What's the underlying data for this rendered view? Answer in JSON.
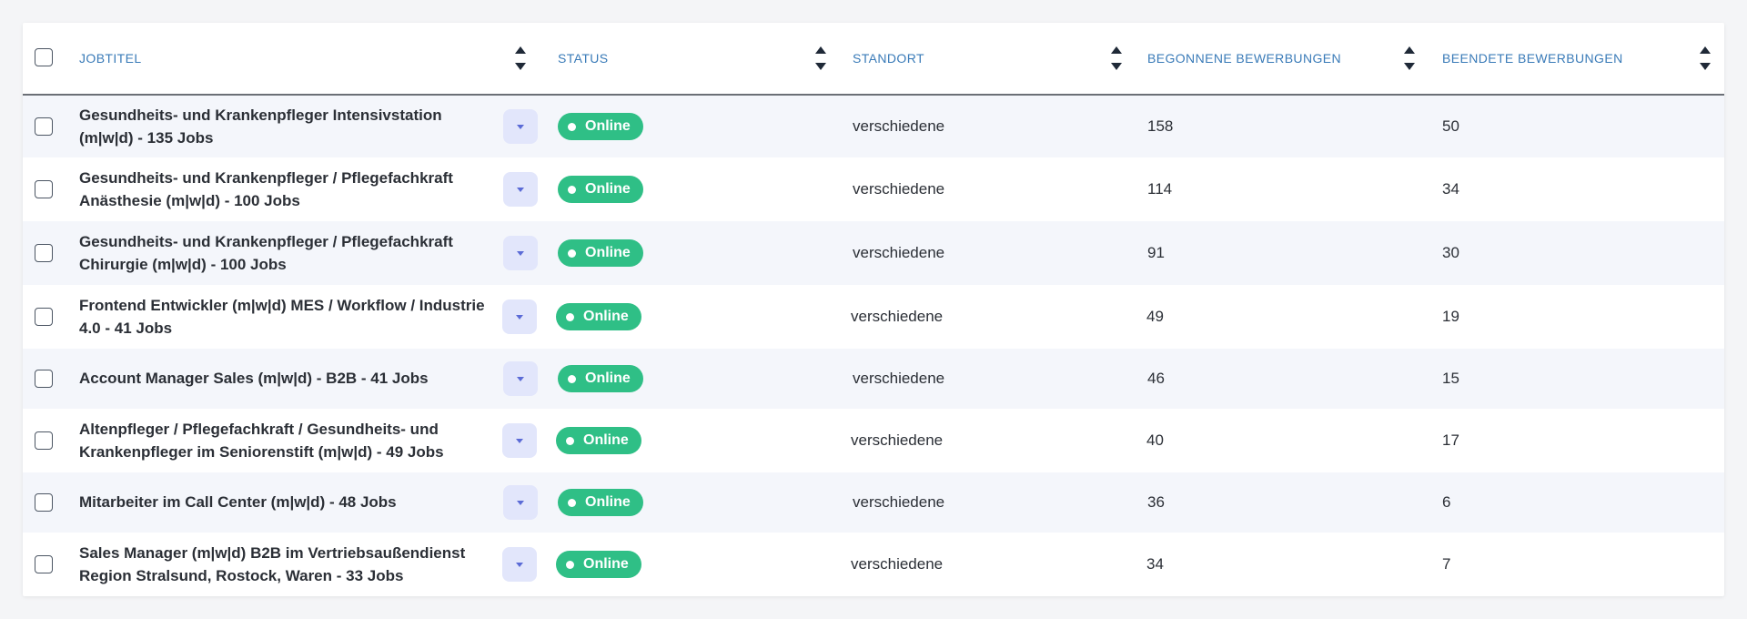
{
  "table": {
    "columns": {
      "jobtitel": "JOBTITEL",
      "status": "STATUS",
      "standort": "STANDORT",
      "begonnene": "BEGONNENE BEWERBUNGEN",
      "beendete": "BEENDETE BEWERBUNGEN"
    },
    "rows": [
      {
        "title": "Gesundheits- und Krankenpfleger Intensivstation (m|w|d) - 135 Jobs",
        "status": "Online",
        "standort": "verschiedene",
        "begonnene": "158",
        "beendete": "50"
      },
      {
        "title": "Gesundheits- und Krankenpfleger / Pflegefachkraft Anästhesie (m|w|d) - 100 Jobs",
        "status": "Online",
        "standort": "verschiedene",
        "begonnene": "114",
        "beendete": "34"
      },
      {
        "title": "Gesundheits- und Krankenpfleger / Pflegefachkraft Chirurgie (m|w|d) - 100 Jobs",
        "status": "Online",
        "standort": "verschiedene",
        "begonnene": "91",
        "beendete": "30"
      },
      {
        "title": "Frontend Entwickler (m|w|d) MES / Workflow / Industrie 4.0 - 41 Jobs",
        "status": "Online",
        "standort": "verschiedene",
        "begonnene": "49",
        "beendete": "19"
      },
      {
        "title": "Account Manager Sales (m|w|d) - B2B - 41 Jobs",
        "status": "Online",
        "standort": "verschiedene",
        "begonnene": "46",
        "beendete": "15"
      },
      {
        "title": "Altenpfleger / Pflegefachkraft / Gesundheits- und Krankenpfleger im Seniorenstift (m|w|d) - 49 Jobs",
        "status": "Online",
        "standort": "verschiedene",
        "begonnene": "40",
        "beendete": "17"
      },
      {
        "title": "Mitarbeiter im Call Center (m|w|d) - 48 Jobs",
        "status": "Online",
        "standort": "verschiedene",
        "begonnene": "36",
        "beendete": "6"
      },
      {
        "title": "Sales Manager (m|w|d) B2B im Vertriebsaußendienst Region Stralsund, Rostock, Waren - 33 Jobs",
        "status": "Online",
        "standort": "verschiedene",
        "begonnene": "34",
        "beendete": "7"
      }
    ]
  },
  "colors": {
    "header_text": "#3a7bb8",
    "status_online": "#2fbf86",
    "dropdown_bg": "#e2e6fb",
    "row_alt": "#f4f6fb"
  },
  "icons": {
    "sort": "sort-arrows-icon",
    "dropdown": "caret-down-icon",
    "status": "status-dot-icon"
  }
}
